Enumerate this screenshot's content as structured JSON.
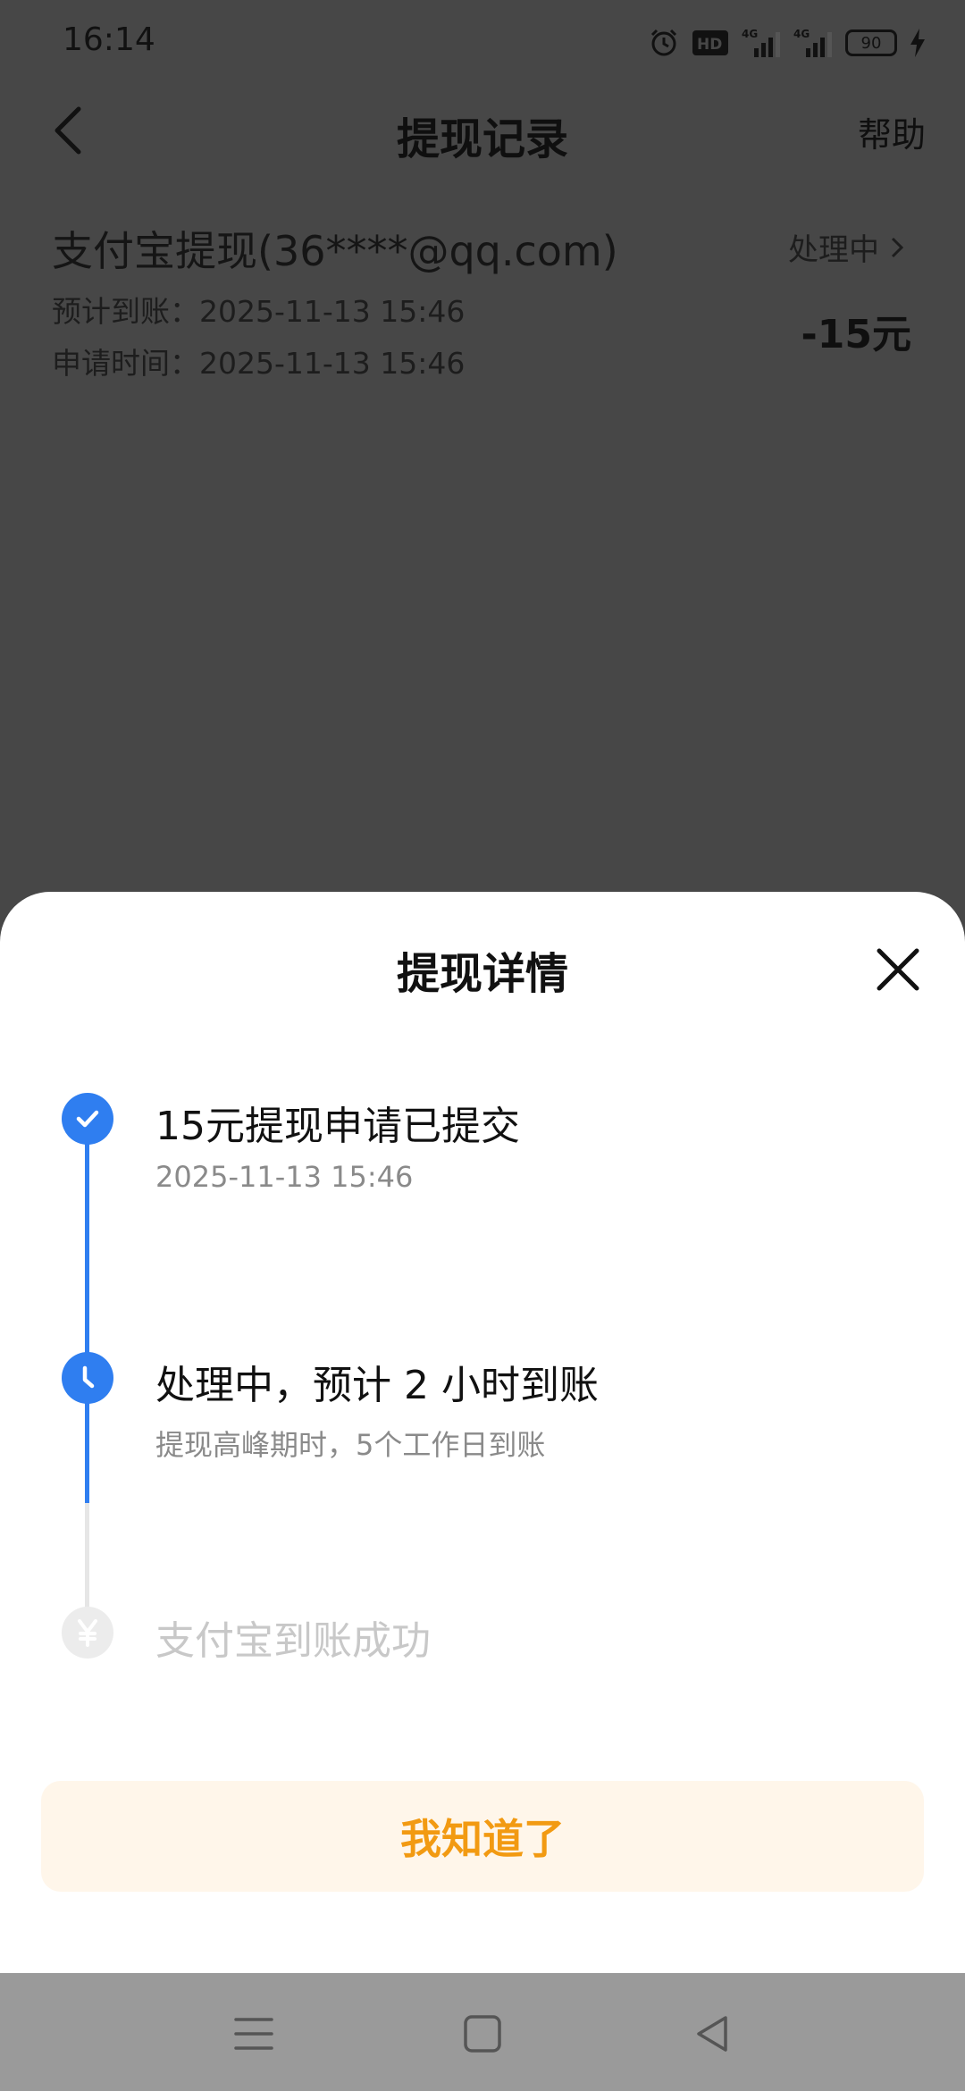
{
  "status_bar": {
    "time": "16:14",
    "battery_level": "90",
    "icons": [
      "alarm-icon",
      "hd-icon",
      "signal-4g-icon",
      "signal-4g-icon",
      "battery-icon",
      "charging-icon"
    ]
  },
  "nav": {
    "back_icon": "chevron-left-icon",
    "title": "提现记录",
    "help": "帮助"
  },
  "record": {
    "title": "支付宝提现(36****@qq.com)",
    "expected_arrival": "预计到账：2025-11-13 15:46",
    "apply_time": "申请时间：2025-11-13 15:46",
    "status": "处理中",
    "amount": "-15元"
  },
  "sheet": {
    "title": "提现详情",
    "close_icon": "close-icon",
    "steps": [
      {
        "title": "15元提现申请已提交",
        "subtitle": "2025-11-13 15:46",
        "icon": "check-icon",
        "state": "done"
      },
      {
        "title": "处理中，预计 2 小时到账",
        "subtitle": "提现高峰期时，5个工作日到账",
        "icon": "clock-icon",
        "state": "active"
      },
      {
        "title": "支付宝到账成功",
        "subtitle": "",
        "icon": "yuan-icon",
        "state": "pending"
      }
    ],
    "ok_button": "我知道了"
  },
  "colors": {
    "accent_blue": "#2f7ef0",
    "button_text": "#f29a12",
    "button_bg": "#fff6ea",
    "overlay": "#474747"
  }
}
